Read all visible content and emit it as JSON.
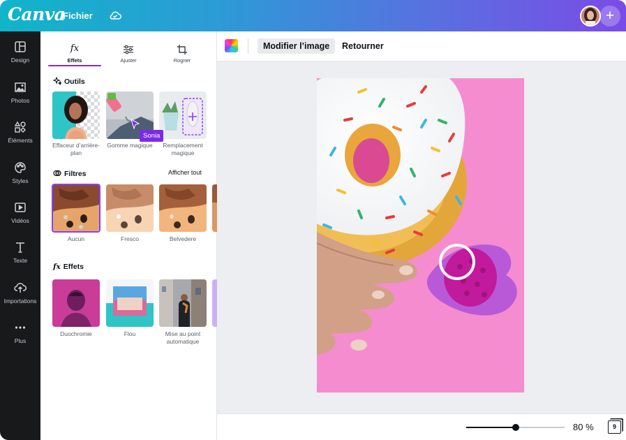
{
  "app": {
    "logo": "Canva",
    "menu_file": "Fichier"
  },
  "rail": {
    "items": [
      {
        "label": "Design",
        "icon": "layout-icon"
      },
      {
        "label": "Photos",
        "icon": "image-icon"
      },
      {
        "label": "Éléments",
        "icon": "shapes-icon"
      },
      {
        "label": "Styles",
        "icon": "palette-icon"
      },
      {
        "label": "Vidéos",
        "icon": "video-icon"
      },
      {
        "label": "Texte",
        "icon": "text-icon"
      },
      {
        "label": "Importations",
        "icon": "upload-icon"
      },
      {
        "label": "Plus",
        "icon": "more-icon"
      }
    ]
  },
  "panel": {
    "tabs": [
      {
        "label": "Effets",
        "icon": "fx",
        "active": true
      },
      {
        "label": "Ajuster",
        "icon": "sliders-icon"
      },
      {
        "label": "Rogner",
        "icon": "crop-icon"
      }
    ],
    "tools": {
      "title": "Outils",
      "items": [
        "Effaceur d’arrière-plan",
        "Gomme magique",
        "Remplacement magique"
      ]
    },
    "filters": {
      "title": "Filtres",
      "show_all": "Afficher tout",
      "items": [
        "Aucun",
        "Fresco",
        "Belvedere"
      ],
      "selected": "Aucun"
    },
    "effects": {
      "title": "Effets",
      "items": [
        "Duochromie",
        "Flou",
        "Mise au point automatique"
      ]
    },
    "cursor_tag": "Sonia"
  },
  "editor": {
    "toolbar": {
      "edit_label": "Modifier l’image",
      "flip_label": "Retourner"
    },
    "zoom": {
      "value_label": "80 %",
      "level": 0.5
    },
    "pages": "9"
  },
  "colors": {
    "accent": "#7d2ae8",
    "rail_bg": "#18191b",
    "canvas_bg": "#eceef1",
    "photo_pink": "#f58ccf"
  }
}
